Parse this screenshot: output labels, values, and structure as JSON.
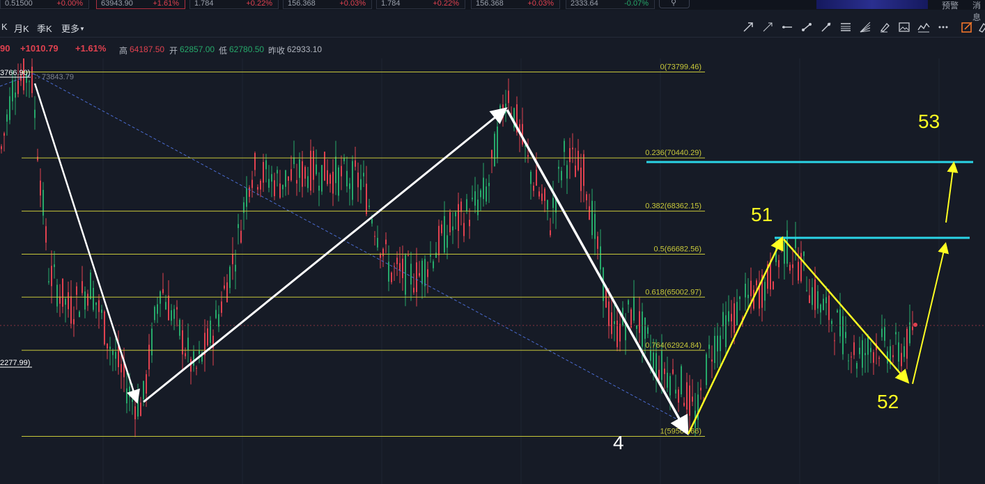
{
  "ticker": [
    {
      "value": "0.51500",
      "change": "+0.00%",
      "dir": "up"
    },
    {
      "value": "63943.90",
      "change": "+1.61%",
      "dir": "up"
    },
    {
      "value": "1.784",
      "change": "+0.22%",
      "dir": "up"
    },
    {
      "value": "156.368",
      "change": "+0.03%",
      "dir": "up"
    },
    {
      "value": "1.784",
      "change": "+0.22%",
      "dir": "up"
    },
    {
      "value": "156.368",
      "change": "+0.03%",
      "dir": "up"
    },
    {
      "value": "2333.64",
      "change": "-0.07%",
      "dir": "down"
    }
  ],
  "header_links": {
    "alert": "预警",
    "message": "消息"
  },
  "periods": [
    "K",
    "月K",
    "季K",
    "更多"
  ],
  "tools": [
    "trend-line-icon",
    "ray-icon",
    "horizontal-line-icon",
    "segment-icon",
    "arrow-icon",
    "parallel-channel-icon",
    "fib-fan-icon",
    "brush-icon",
    "image-icon",
    "wave-icon",
    "more-tools-icon",
    "drawing-mode-icon",
    "eraser-icon"
  ],
  "quote": {
    "price_partial": "90",
    "change": "+1010.79",
    "change_pct": "+1.61%",
    "high_label": "高",
    "high": "64187.50",
    "open_label": "开",
    "open": "62857.00",
    "low_label": "低",
    "low": "62780.50",
    "prev_label": "昨收",
    "prev": "62933.10"
  },
  "chart": {
    "high_marker": "3766.90)",
    "high_marker_ref": "73843.79",
    "low_marker": "2277.99)",
    "fib_levels": [
      {
        "ratio": 0,
        "price": 73799.46,
        "label": "0(73799.46)"
      },
      {
        "ratio": 0.236,
        "price": 70440.29,
        "label": "0.236(70440.29)"
      },
      {
        "ratio": 0.382,
        "price": 68362.15,
        "label": "0.382(68362.15)"
      },
      {
        "ratio": 0.5,
        "price": 66682.56,
        "label": "0.5(66682.56)"
      },
      {
        "ratio": 0.618,
        "price": 65002.97,
        "label": "0.618(65002.97)"
      },
      {
        "ratio": 0.764,
        "price": 62924.84,
        "label": "0.764(62924.84)"
      },
      {
        "ratio": 1,
        "price": 59563.66,
        "label": "1(59563.66)"
      }
    ],
    "wave_labels": [
      "53",
      "51",
      "52",
      "4"
    ],
    "colors": {
      "up": "#e0414f",
      "down": "#26a86a",
      "fib": "#c8c83a",
      "target": "#2ad4e6",
      "forecast": "#ffff22",
      "wave": "#ffffff"
    }
  }
}
